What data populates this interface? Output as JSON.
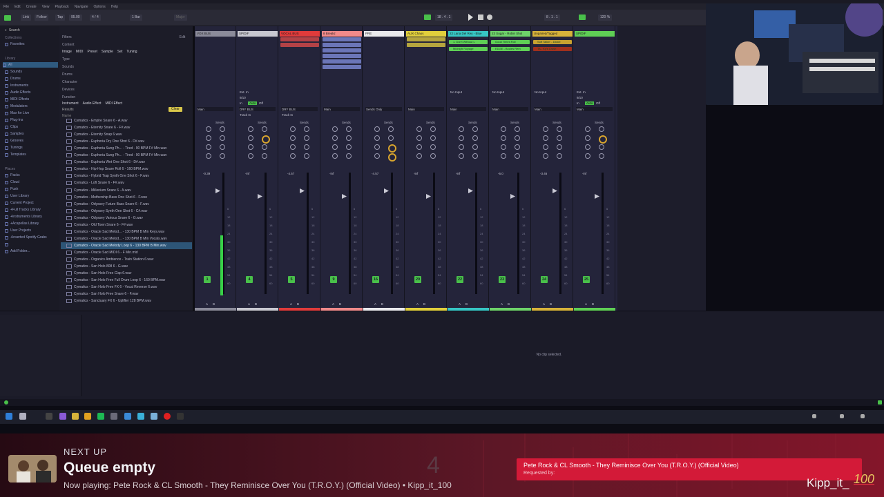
{
  "menu": [
    "File",
    "Edit",
    "Create",
    "View",
    "Playback",
    "Navigate",
    "Options",
    "Help"
  ],
  "transport": {
    "link": "Link",
    "follow": "Follow",
    "tap": "Tap",
    "tempo": "95.00",
    "time_sig": "4 / 4",
    "bar": "1 Bar",
    "key": "Major",
    "position": "18 . 4 . 1",
    "end": "8 . 1 . 1",
    "zoom": "120 %"
  },
  "browser": {
    "search_placeholder": "Search",
    "collections_head": "Collections",
    "favorites": "Favorites",
    "library_head": "Library",
    "library_items": [
      "All",
      "Sounds",
      "Drums",
      "Instruments",
      "Audio Effects",
      "MIDI Effects",
      "Modulators",
      "Max for Live",
      "Plug-Ins",
      "Clips",
      "Samples",
      "Grooves",
      "Tunings",
      "Templates"
    ],
    "places_head": "Places",
    "places_items": [
      "Packs",
      "Cloud",
      "Push",
      "User Library",
      "Current Project",
      "+Full Tracks Library",
      "+Instruments Library",
      "+Acapellas Library",
      "User Projects",
      "+Inserted Spotify Grabs",
      "",
      "Add Folder..."
    ],
    "filters_label": "Filters",
    "edit_label": "Edit",
    "content_label": "Content",
    "content_tags": [
      "Image",
      "MIDI",
      "Preset",
      "Sample",
      "Set",
      "Tuning"
    ],
    "filter_groups": [
      "Type",
      "Sounds",
      "Drums",
      "Character",
      "Devices",
      "Function"
    ],
    "function_tags": [
      "Instrument",
      "Audio Effect",
      "MIDI Effect"
    ],
    "results_label": "Results",
    "clear_label": "Clear",
    "name_col": "Name",
    "files": [
      "Cymatics - Empire Snare 6 - A.wav",
      "Cymatics - Eternity Snare 6 - F#.wav",
      "Cymatics - Eternity Snap 6.wav",
      "Cymatics - Euphoria Dry One Shot 6 - D#.wav",
      "Cymatics - Euphoria Sung Ph... - Tired - 90 BPM F# Min.wav",
      "Cymatics - Euphoria Sung Ph... - Tired - 90 BPM F# Min.wav",
      "Cymatics - Euphoria Wet One Shot 6 - D#.wav",
      "Cymatics - Hip-Hop Snare Roll 6 - 160 BPM.wav",
      "Cymatics - Hybrid Trap Synth One Shot 6 - F.wav",
      "Cymatics - Loft Snare 6 - F#.wav",
      "Cymatics - Millenium Snare 6 - A.wav",
      "Cymatics - Mothership Bass One Shot 6 - F.wav",
      "Cymatics - Odyssey Future Bass Snare 6 - F.wav",
      "Cymatics - Odyssey Synth One Shot 6 - C#.wav",
      "Cymatics - Odyssey Various Snare 6 - G.wav",
      "Cymatics - Old Town Snare 6 - F#.wav",
      "Cymatics - Oracle Sad Melod... - 130 BPM B Min Keys.wav",
      "Cymatics - Oracle Sad Melod... - 130 BPM B Min Vocals.wav",
      "Cymatics - Oracle Sad Melody Loop 6 - 130 BPM B Min.wav",
      "Cymatics - Oracle Sad MIDI 6 - F Min.mid",
      "Cymatics - Organics Ambience - Train Station 6.wav",
      "Cymatics - San Holo 808 6 - G.wav",
      "Cymatics - San Holo Free Clap 6.wav",
      "Cymatics - San Holo Free Full Drum Loop 6 - 160 BPM.wav",
      "Cymatics - San Holo Free FX 6 - Vocal Reverse 6.wav",
      "Cymatics - San Holo Free Snare 6 - F.wav",
      "Cymatics - Sanctuary FX 6 - Uplifter 128 BPM.wav"
    ],
    "selected_index": 18
  },
  "tracks": [
    {
      "name": "VOX BUS",
      "color": "#8b8b9a",
      "num": "1",
      "db": "-0.39",
      "meter": 0.62,
      "input": "",
      "route": "Main"
    },
    {
      "name": "SP/DIF",
      "color": "#c8c8d0",
      "num": "4",
      "db": "-inf",
      "meter": 0,
      "input": "Ext. In",
      "route": "DRY BUS"
    },
    {
      "name": "VOCAL BUS",
      "color": "#e03b3b",
      "num": "5",
      "db": "-4.57",
      "meter": 0,
      "input": "",
      "route": "DRY BUS"
    },
    {
      "name": "8 Breakz",
      "color": "#f08a8a",
      "num": "9",
      "db": "-inf",
      "meter": 0,
      "input": "",
      "route": "Main"
    },
    {
      "name": "PRE",
      "color": "#e9e9ec",
      "num": "16",
      "db": "-4.57",
      "meter": 0,
      "input": "",
      "route": "Sends Only"
    },
    {
      "name": "AUX Chaos",
      "color": "#e1cf3c",
      "num": "20",
      "db": "-inf",
      "meter": 0,
      "input": "",
      "route": "Main"
    },
    {
      "name": "22 Lana Del Rey - Blue",
      "color": "#37c6c4",
      "num": "22",
      "db": "-inf",
      "meter": 0,
      "input": "No Input",
      "route": "Main"
    },
    {
      "name": "23 Sugar - Robin Shul",
      "color": "#6ed36a",
      "num": "23",
      "db": "-6.0",
      "meter": 0,
      "input": "No Input",
      "route": "Main"
    },
    {
      "name": "Unpaired/Tagged",
      "color": "#d6b23a",
      "num": "24",
      "db": "-3.46",
      "meter": 0,
      "input": "No Input",
      "route": "Main"
    },
    {
      "name": "SP/DIF",
      "color": "#5fcf55",
      "num": "25",
      "db": "-inf",
      "meter": 0,
      "input": "Ext. In",
      "route": "Main"
    }
  ],
  "clips": {
    "lana_1": "1. Don't Without L",
    "lana_2": "Midnight Voyage",
    "sugar_1": "Good Times Roll",
    "sugar_2": "EDGE - Bouies Rem",
    "unpaired_1": "Soft Talkin' - Dickie",
    "unpaired_2": "TA - Ky's Crush"
  },
  "mixer_labels": {
    "sends": "Sends",
    "track_in": "Track In",
    "in": "In",
    "auto": "Auto",
    "off": "Off",
    "spdif_ch": "9/10",
    "ab": "A B"
  },
  "detail": {
    "no_clip": "No clip selected."
  },
  "overlay": {
    "next_up": "NEXT UP",
    "queue": "Queue empty",
    "now_playing": "Now playing: Pete Rock & CL Smooth - They Reminisce Over You (T.R.O.Y.) (Official Video) • Kipp_it_100",
    "big_number": "4",
    "request_title": "Pete Rock & CL Smooth - They Reminisce Over You (T.R.O.Y.) (Official Video)",
    "requested_by": "Requested by:",
    "channel": "Kipp_it_",
    "channel_100": "100"
  },
  "colors": {
    "accent_green": "#49c04a",
    "overlay_red": "#d31a38",
    "selection_blue": "#2d5577"
  }
}
